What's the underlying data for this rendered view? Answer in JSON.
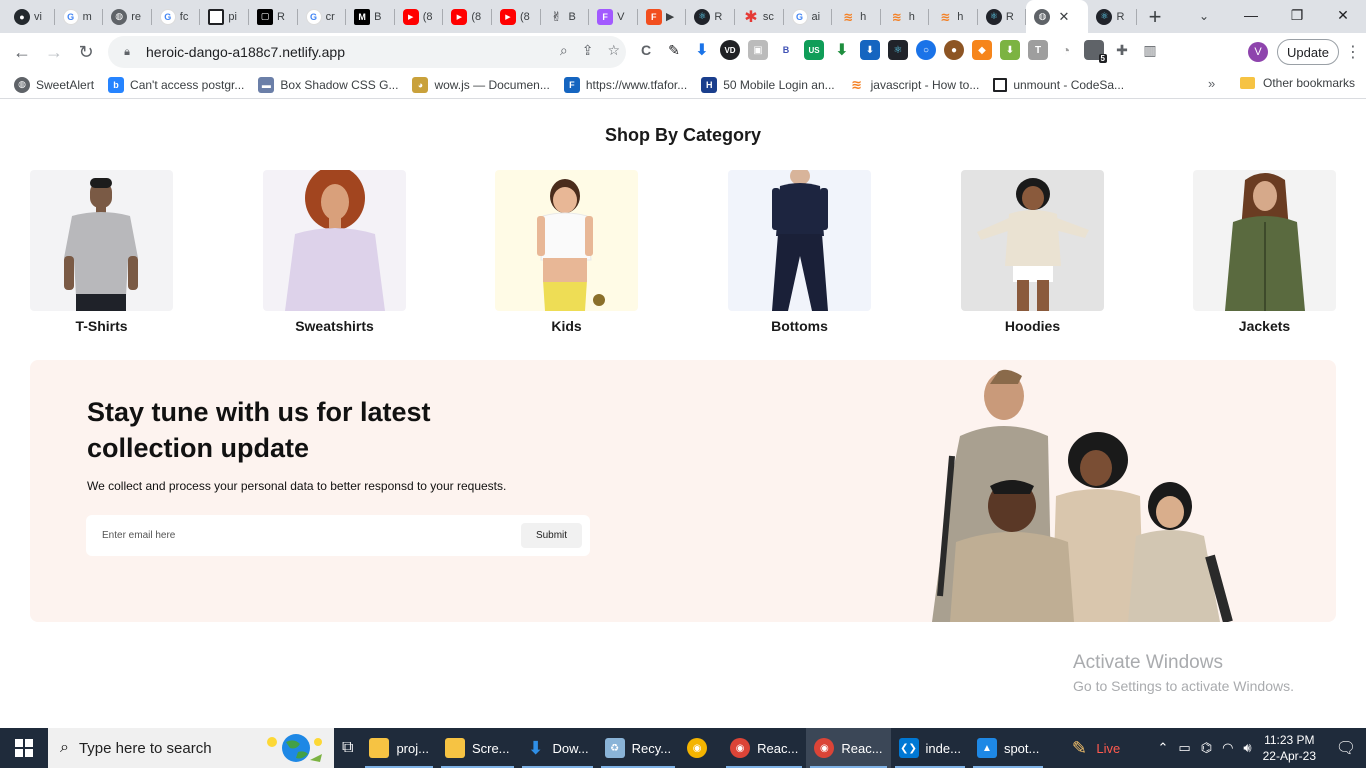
{
  "browser": {
    "tabs": [
      {
        "title": "vi",
        "icon": "github-icon",
        "color": "#24292e"
      },
      {
        "title": "m",
        "icon": "google-icon",
        "color": "#4285f4"
      },
      {
        "title": "re",
        "icon": "globe-icon",
        "color": "#5f6368"
      },
      {
        "title": "fc",
        "icon": "google-icon",
        "color": "#4285f4"
      },
      {
        "title": "pi",
        "icon": "square-icon",
        "color": "#202124"
      },
      {
        "title": "R",
        "icon": "notion-icon",
        "color": "#000000"
      },
      {
        "title": "cr",
        "icon": "google-icon",
        "color": "#4285f4"
      },
      {
        "title": "B",
        "icon": "medium-icon",
        "color": "#000000"
      },
      {
        "title": "(8",
        "icon": "youtube-icon",
        "color": "#ff0000"
      },
      {
        "title": "(8",
        "icon": "youtube-icon",
        "color": "#ff0000"
      },
      {
        "title": "(8",
        "icon": "youtube-icon",
        "color": "#ff0000"
      },
      {
        "title": "B",
        "icon": "peace-icon",
        "color": "#202124"
      },
      {
        "title": "V",
        "icon": "figma-icon",
        "color": "#a259ff"
      },
      {
        "title": "▶",
        "icon": "figma-icon",
        "color": "#f24e1e"
      },
      {
        "title": "R",
        "icon": "react-icon",
        "color": "#20232a"
      },
      {
        "title": "sc",
        "icon": "asterisk-icon",
        "color": "#e53935"
      },
      {
        "title": "ai",
        "icon": "google-icon",
        "color": "#4285f4"
      },
      {
        "title": "h",
        "icon": "stackoverflow-icon",
        "color": "#f48024"
      },
      {
        "title": "h",
        "icon": "stackoverflow-icon",
        "color": "#f48024"
      },
      {
        "title": "h",
        "icon": "stackoverflow-icon",
        "color": "#f48024"
      },
      {
        "title": "R",
        "icon": "react-icon",
        "color": "#20232a"
      }
    ],
    "active_tab_icon": "globe-icon",
    "last_tab_title": "R",
    "url": "heroic-dango-a188c7.netlify.app",
    "update_label": "Update",
    "profile_initial": "V",
    "extension_badge": "5",
    "bookmarks": [
      {
        "label": "SweetAlert",
        "icon": "globe-icon",
        "color": "#5f6368"
      },
      {
        "label": "Can't access postgr...",
        "icon": "bitbucket-icon",
        "color": "#2684ff"
      },
      {
        "label": "Box Shadow CSS G...",
        "icon": "image-icon",
        "color": "#6b7fa8"
      },
      {
        "label": "wow.js — Documen...",
        "icon": "doge-icon",
        "color": "#c9a13b"
      },
      {
        "label": "https://www.tfafor...",
        "icon": "f-icon",
        "color": "#1565c0"
      },
      {
        "label": "50 Mobile Login an...",
        "icon": "h-icon",
        "color": "#1a3e8c"
      },
      {
        "label": "javascript - How to...",
        "icon": "stackoverflow-icon",
        "color": "#f48024"
      },
      {
        "label": "unmount - CodeSa...",
        "icon": "codesandbox-icon",
        "color": "#202124"
      }
    ],
    "other_bookmarks": "Other bookmarks"
  },
  "page": {
    "category_title": "Shop By Category",
    "categories": [
      {
        "name": "T-Shirts",
        "bg": "#f3f3f5"
      },
      {
        "name": "Sweatshirts",
        "bg": "#f4f2f7"
      },
      {
        "name": "Kids",
        "bg": "#fffbe6"
      },
      {
        "name": "Bottoms",
        "bg": "#f1f4fb"
      },
      {
        "name": "Hoodies",
        "bg": "#e3e3e3"
      },
      {
        "name": "Jackets",
        "bg": "#f3f3f3"
      }
    ],
    "newsletter": {
      "heading": "Stay tune with us for latest collection update",
      "subtext": "We collect and process your personal data to better responsd to your requests.",
      "placeholder": "Enter email here",
      "submit_label": "Submit",
      "bg": "#fdf3ef"
    },
    "watermark": {
      "line1": "Activate Windows",
      "line2": "Go to Settings to activate Windows."
    }
  },
  "taskbar": {
    "search_placeholder": "Type here to search",
    "items": [
      {
        "label": "proj...",
        "icon": "folder-icon",
        "color": "#f6c343"
      },
      {
        "label": "Scre...",
        "icon": "folder-icon",
        "color": "#f6c343"
      },
      {
        "label": "Dow...",
        "icon": "download-icon",
        "color": "#2f8fe6"
      },
      {
        "label": "Recy...",
        "icon": "recycle-bin-icon",
        "color": "#8ab4d8"
      },
      {
        "label": "",
        "icon": "chrome-canary-icon",
        "color": "#f4b400"
      },
      {
        "label": "Reac...",
        "icon": "chrome-icon",
        "color": "#db4437"
      },
      {
        "label": "Reac...",
        "icon": "chrome-icon",
        "color": "#db4437"
      },
      {
        "label": "inde...",
        "icon": "vscode-icon",
        "color": "#0078d4"
      },
      {
        "label": "spot...",
        "icon": "photos-icon",
        "color": "#1e88e5"
      },
      {
        "label": "Live",
        "icon": "live-icon",
        "color": "#e53935"
      }
    ],
    "time": "11:23 PM",
    "date": "22-Apr-23"
  }
}
